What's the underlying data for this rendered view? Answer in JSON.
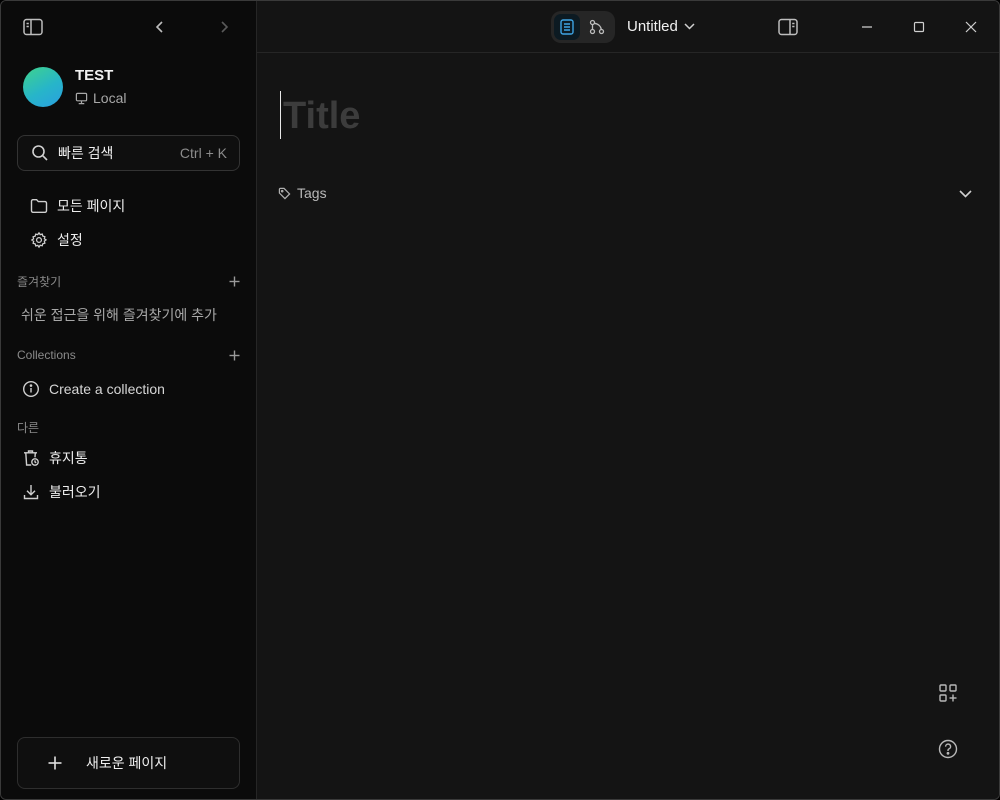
{
  "window": {
    "accent": "#3ea4e4",
    "background": "#141414",
    "sidebar_background": "#0b0b0b"
  },
  "sidebar": {
    "toggle_icon": "sidebar-panel-icon",
    "nav": {
      "back_icon": "chevron-left-icon",
      "forward_icon": "chevron-right-icon"
    },
    "workspace": {
      "name": "TEST",
      "type": "Local",
      "type_icon": "monitor-icon"
    },
    "search": {
      "label": "빠른 검색",
      "shortcut": "Ctrl + K"
    },
    "items": [
      {
        "label": "모든 페이지",
        "icon": "folder-icon"
      },
      {
        "label": "설정",
        "icon": "gear-icon"
      }
    ],
    "favorites": {
      "title": "즐겨찾기",
      "hint": "쉬운 접근을 위해 즐겨찾기에 추가"
    },
    "collections": {
      "title": "Collections",
      "create_label": "Create a collection"
    },
    "others": {
      "title": "다른",
      "items": [
        {
          "label": "휴지통",
          "icon": "trash-icon"
        },
        {
          "label": "불러오기",
          "icon": "download-icon"
        }
      ]
    },
    "new_page": {
      "label": "새로운 페이지"
    }
  },
  "header": {
    "mode": {
      "active": "page",
      "options": [
        "page",
        "edgeless"
      ]
    },
    "doc_title": "Untitled"
  },
  "editor": {
    "title_placeholder": "Title",
    "tags_label": "Tags"
  }
}
